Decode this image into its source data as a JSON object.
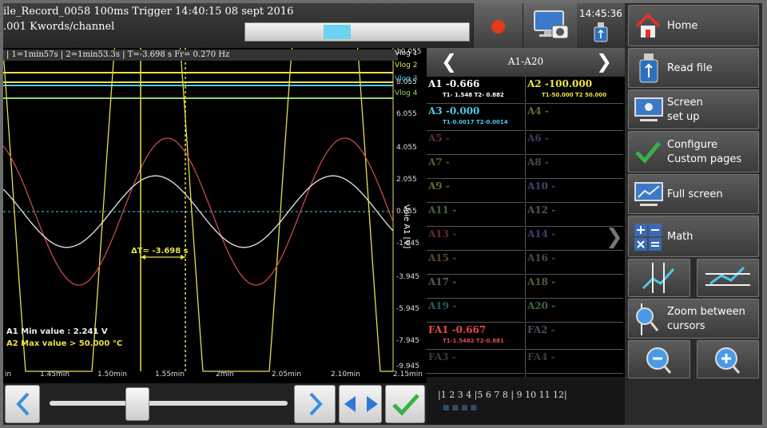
{
  "header": {
    "line1": "ile_Record_0058  100ms  Trigger 14:40:15 08 sept 2016",
    "line2": ".001 Kwords/channel",
    "scroll_position": 0.35,
    "record_icon": "record-icon",
    "screenshot_icon": "camera-monitor-icon",
    "usb_icon": "usb-icon",
    "clock": "14:45:36"
  },
  "graph": {
    "infobar": "| 1=1min57s  |  2=1min53.3s  |  T=-3.698 s Fr= 0.270 Hz",
    "y_ticks": [
      "10.055",
      "8.055",
      "6.055",
      "4.055",
      "2.055",
      "0.055",
      "-1.945",
      "-3.945",
      "-5.945",
      "-7.945",
      "-9.945"
    ],
    "y_axis_title": "Voie A1 [V]",
    "vlogs": [
      "Vlog 1",
      "Vlog 2",
      "Vlog 3",
      "Vlog 4"
    ],
    "x_ticks": [
      "in",
      "1.45min",
      "1.50min",
      "1.55min",
      "2min",
      "2.05min",
      "2.10min",
      "2.15min"
    ],
    "cursor_delta": "ΔT= -3.698 s",
    "annotation_min": "A1 Min value : 2.241 V",
    "annotation_max": "A2 Max value > 50.000 °C",
    "colors": {
      "white": "#e6e6e6",
      "red": "#c84a4a",
      "yellow": "#e6e04a",
      "cyan": "#4fc8e8",
      "green": "#9ad36a"
    }
  },
  "channels": {
    "title": "A1-A20",
    "cells": [
      {
        "name": "A1 -0.666",
        "sub": "T1- 1.548 T2- 0.882",
        "color": "#ffffff"
      },
      {
        "name": "A2 -100.000",
        "sub": "T1-50.000 T2 50.000",
        "color": "#ece44a"
      },
      {
        "name": "A3 -0.000",
        "sub": "T1-0.0017 T2-0.0014",
        "color": "#4fc8e8"
      },
      {
        "name": "A4 -",
        "sub": "",
        "color": "#6a6a3a"
      },
      {
        "name": "A5 -",
        "sub": "",
        "color": "#5a3030"
      },
      {
        "name": "A6 -",
        "sub": "",
        "color": "#4a3a5a"
      },
      {
        "name": "A7 -",
        "sub": "",
        "color": "#5a5a2a"
      },
      {
        "name": "A8 -",
        "sub": "",
        "color": "#4a4a4a"
      },
      {
        "name": "A9 -",
        "sub": "",
        "color": "#6a6a2a"
      },
      {
        "name": "A10 -",
        "sub": "",
        "color": "#3a4a6a"
      },
      {
        "name": "A11 -",
        "sub": "",
        "color": "#3a6a3a"
      },
      {
        "name": "A12 -",
        "sub": "",
        "color": "#4a5a4a"
      },
      {
        "name": "A13 -",
        "sub": "",
        "color": "#6a2a2a"
      },
      {
        "name": "A14 -",
        "sub": "",
        "color": "#4a3a6a"
      },
      {
        "name": "A15 -",
        "sub": "",
        "color": "#5a4a2a"
      },
      {
        "name": "A16 -",
        "sub": "",
        "color": "#4a4a4a"
      },
      {
        "name": "A17 -",
        "sub": "",
        "color": "#5a5a5a"
      },
      {
        "name": "A18 -",
        "sub": "",
        "color": "#5a5a3a"
      },
      {
        "name": "A19 -",
        "sub": "",
        "color": "#2a5a5a"
      },
      {
        "name": "A20 -",
        "sub": "",
        "color": "#3a6a3a"
      },
      {
        "name": "FA1 -0.667",
        "sub": "T1-1.5482 T2-0.881",
        "color": "#e84a4a"
      },
      {
        "name": "FA2 -",
        "sub": "",
        "color": "#4a4a5a"
      },
      {
        "name": "FA3 -",
        "sub": "",
        "color": "#3a3a3a"
      },
      {
        "name": "FA4 -",
        "sub": "",
        "color": "#3a3a3a"
      }
    ],
    "pages": "|1  2  3  4 |5  6  7  8 | 9  10  11  12|",
    "page_dots": "■■■■"
  },
  "menu": {
    "home": "Home",
    "read_file": "Read file",
    "screen_setup_1": "Screen",
    "screen_setup_2": "set up",
    "configure_1": "Configure",
    "configure_2": "Custom pages",
    "full_screen": "Full screen",
    "math": "Math",
    "zoom_1": "Zoom between",
    "zoom_2": "cursors"
  },
  "bottom": {
    "prev_icon": "chevron-left-icon",
    "next_icon": "chevron-right-icon",
    "swap_icon": "double-arrow-icon",
    "confirm_icon": "checkmark-icon",
    "slider_position": 0.37
  }
}
